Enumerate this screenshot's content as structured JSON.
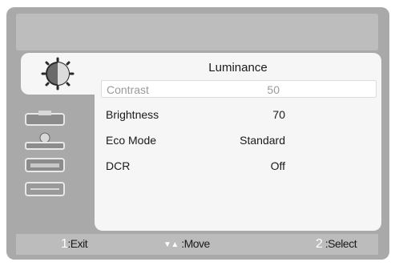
{
  "menu": {
    "title": "Luminance",
    "items": [
      {
        "label": "Contrast",
        "value": "50",
        "selected": true
      },
      {
        "label": "Brightness",
        "value": "70",
        "selected": false
      },
      {
        "label": "Eco Mode",
        "value": "Standard",
        "selected": false
      },
      {
        "label": "DCR",
        "value": "Off",
        "selected": false
      }
    ]
  },
  "icons": [
    "luminance-icon",
    "image-setup-icon",
    "color-temp-icon",
    "osd-setup-icon",
    "extra-icon"
  ],
  "footer": {
    "exit_key": "1",
    "exit_label": ":Exit",
    "move_arrows": "▼▲",
    "move_label": ":Move",
    "select_key": "2",
    "select_label": ":Select"
  }
}
